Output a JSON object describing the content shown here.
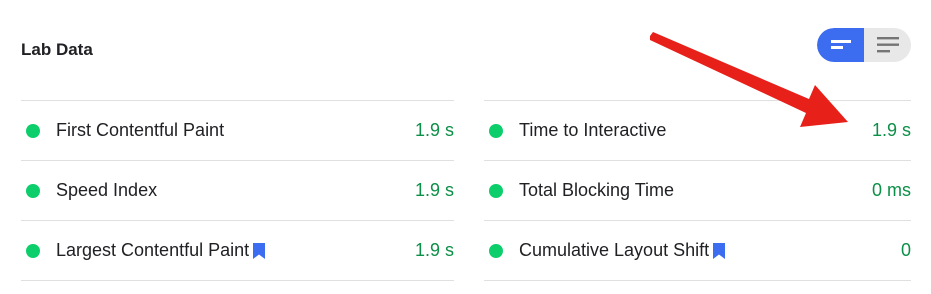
{
  "header": {
    "title": "Lab Data"
  },
  "view_toggle": {
    "left_icon": "list-compact-icon",
    "right_icon": "list-expanded-icon"
  },
  "metrics_left": [
    {
      "label": "First Contentful Paint",
      "value": "1.9 s",
      "bookmark": false
    },
    {
      "label": "Speed Index",
      "value": "1.9 s",
      "bookmark": false
    },
    {
      "label": "Largest Contentful Paint",
      "value": "1.9 s",
      "bookmark": true
    }
  ],
  "metrics_right": [
    {
      "label": "Time to Interactive",
      "value": "1.9 s",
      "bookmark": false
    },
    {
      "label": "Total Blocking Time",
      "value": "0 ms",
      "bookmark": false
    },
    {
      "label": "Cumulative Layout Shift",
      "value": "0",
      "bookmark": true
    }
  ],
  "colors": {
    "pass": "#0cce6b",
    "pass_text": "#0c8f48",
    "accent": "#3c6df0",
    "annotation_arrow": "#e8201a"
  }
}
